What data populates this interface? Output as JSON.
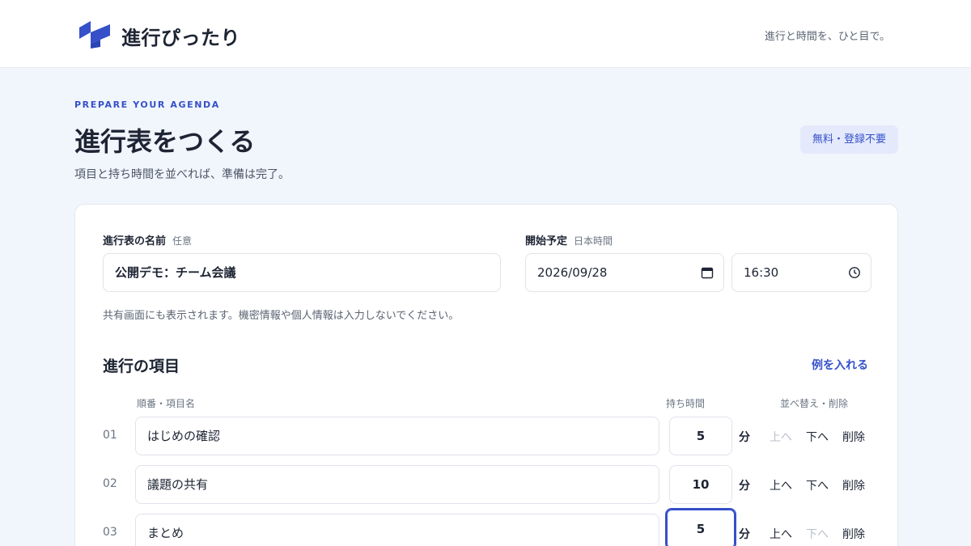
{
  "header": {
    "brand": "進行ぴったり",
    "tagline": "進行と時間を、ひと目で。"
  },
  "hero": {
    "eyebrow": "PREPARE YOUR AGENDA",
    "title": "進行表をつくる",
    "subtitle": "項目と持ち時間を並べれば、準備は完了。",
    "badge": "無料・登録不要"
  },
  "form": {
    "name_label": "進行表の名前",
    "name_hint": "任意",
    "name_value": "公開デモ：チーム会議",
    "start_label": "開始予定",
    "start_hint": "日本時間",
    "date_value": "2026/09/28",
    "time_value": "16:30",
    "note": "共有画面にも表示されます。機密情報や個人情報は入力しないでください。"
  },
  "items_section": {
    "title": "進行の項目",
    "example_link": "例を入れる",
    "col_name": "順番・項目名",
    "col_duration": "持ち時間",
    "col_actions": "並べ替え・削除",
    "unit": "分",
    "up_label": "上へ",
    "down_label": "下へ",
    "delete_label": "削除",
    "rows": [
      {
        "num": "01",
        "name": "はじめの確認",
        "minutes": "5",
        "up_disabled": true,
        "down_disabled": false
      },
      {
        "num": "02",
        "name": "議題の共有",
        "minutes": "10",
        "up_disabled": false,
        "down_disabled": false
      },
      {
        "num": "03",
        "name": "まとめ",
        "minutes": "5",
        "up_disabled": false,
        "down_disabled": true
      }
    ]
  },
  "colors": {
    "accent": "#3550c9",
    "background": "#f1f5fc",
    "text": "#1d2433",
    "muted": "#6b7483"
  }
}
